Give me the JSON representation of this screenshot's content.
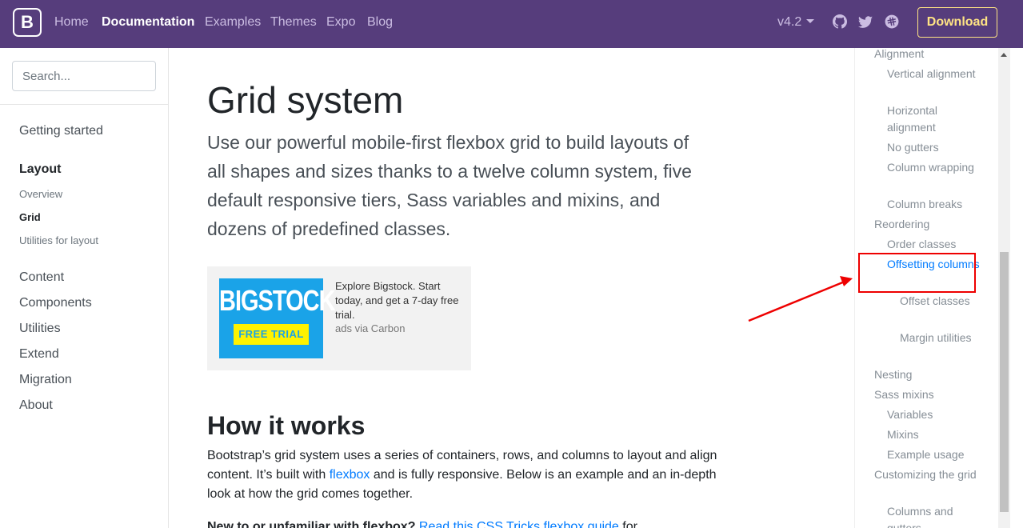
{
  "navbar": {
    "brand": "B",
    "links": [
      "Home",
      "Documentation",
      "Examples",
      "Themes",
      "Expo",
      "Blog"
    ],
    "version": "v4.2",
    "icons": [
      "github-icon",
      "twitter-icon",
      "slack-icon"
    ],
    "download_label": "Download"
  },
  "sidebar": {
    "search_placeholder": "Search...",
    "getting_started": "Getting started",
    "layout": "Layout",
    "layout_items": [
      "Overview",
      "Grid",
      "Utilities for layout"
    ],
    "sections": [
      "Content",
      "Components",
      "Utilities",
      "Extend",
      "Migration",
      "About"
    ]
  },
  "main": {
    "title": "Grid system",
    "lead": "Use our powerful mobile-first flexbox grid to build layouts of all shapes and sizes thanks to a twelve column system, five default responsive tiers, Sass variables and mixins, and dozens of predefined classes.",
    "ad": {
      "logo": "BIGSTOCK",
      "tm": "™",
      "badge": "FREE TRIAL",
      "text": "Explore Bigstock. Start today, and get a 7-day free trial.",
      "via": "ads via Carbon"
    },
    "how_title": "How it works",
    "how_text_1": "Bootstrap’s grid system uses a series of containers, rows, and columns to layout and align content. It’s built with",
    "how_link": "flexbox",
    "how_text_2": "and is fully responsive. Below is an example and an in-depth look at how the grid comes together.",
    "new_bold": "New to or unfamiliar with flexbox?",
    "new_link": "Read this CSS Tricks flexbox guide",
    "new_tail": "for"
  },
  "toc": {
    "items": [
      "Alignment",
      "Vertical alignment",
      "Horizontal alignment",
      "No gutters",
      "Column wrapping",
      "Column breaks",
      "Reordering",
      "Order classes",
      "Offsetting columns",
      "Offset classes",
      "Margin utilities",
      "Nesting",
      "Sass mixins",
      "Variables",
      "Mixins",
      "Example usage",
      "Customizing the grid",
      "Columns and gutters"
    ]
  },
  "colors": {
    "navbar": "#563d7c",
    "download": "#ffe484",
    "link": "#007bff",
    "annotation": "#ee0000"
  }
}
